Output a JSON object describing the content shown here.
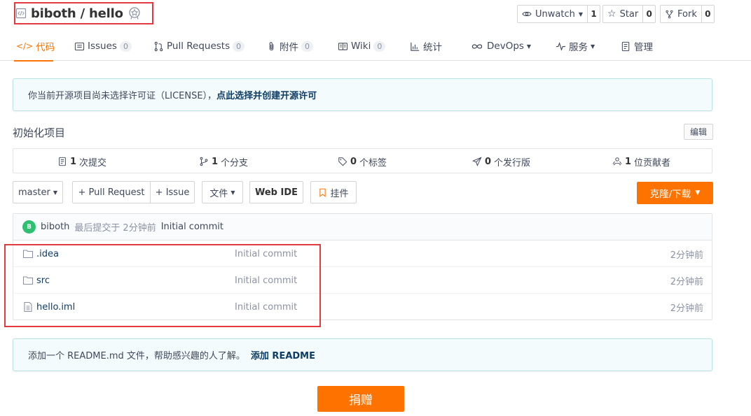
{
  "repo": {
    "name": "biboth / hello"
  },
  "actions": {
    "watch": {
      "label": "Unwatch",
      "count": "1"
    },
    "star": {
      "label": "Star",
      "count": "0"
    },
    "fork": {
      "label": "Fork",
      "count": "0"
    }
  },
  "tabs": [
    {
      "label": "代码"
    },
    {
      "label": "Issues",
      "count": "0"
    },
    {
      "label": "Pull Requests",
      "count": "0"
    },
    {
      "label": "附件",
      "count": "0"
    },
    {
      "label": "Wiki",
      "count": "0"
    },
    {
      "label": "统计"
    },
    {
      "label": "DevOps"
    },
    {
      "label": "服务"
    },
    {
      "label": "管理"
    }
  ],
  "license_notice": {
    "text": "你当前开源项目尚未选择许可证（LICENSE），",
    "link": "点此选择并创建开源许可"
  },
  "description": "初始化项目",
  "edit_label": "编辑",
  "stats": [
    {
      "num": "1",
      "label": "次提交"
    },
    {
      "num": "1",
      "label": "个分支"
    },
    {
      "num": "0",
      "label": "个标签"
    },
    {
      "num": "0",
      "label": "个发行版"
    },
    {
      "num": "1",
      "label": "位贡献者"
    }
  ],
  "toolbar": {
    "branch": "master",
    "pull_request": "+ Pull Request",
    "issue": "+ Issue",
    "files": "文件",
    "web_ide": "Web IDE",
    "pin": "挂件",
    "clone": "克隆/下载"
  },
  "last_commit": {
    "avatar": "B",
    "author": "biboth",
    "verb": "最后提交于",
    "time": "2分钟前",
    "message": "Initial commit"
  },
  "files": [
    {
      "name": ".idea",
      "type": "folder",
      "message": "Initial commit",
      "time": "2分钟前"
    },
    {
      "name": "src",
      "type": "folder",
      "message": "Initial commit",
      "time": "2分钟前"
    },
    {
      "name": "hello.iml",
      "type": "file",
      "message": "Initial commit",
      "time": "2分钟前"
    }
  ],
  "readme_notice": {
    "text": "添加一个 README.md 文件，帮助感兴趣的人了解。",
    "link": "添加 README"
  },
  "donate_label": "捐赠",
  "colors": {
    "accent": "#fe7300",
    "link": "#0d3d66",
    "highlight": "#e23a3f"
  }
}
